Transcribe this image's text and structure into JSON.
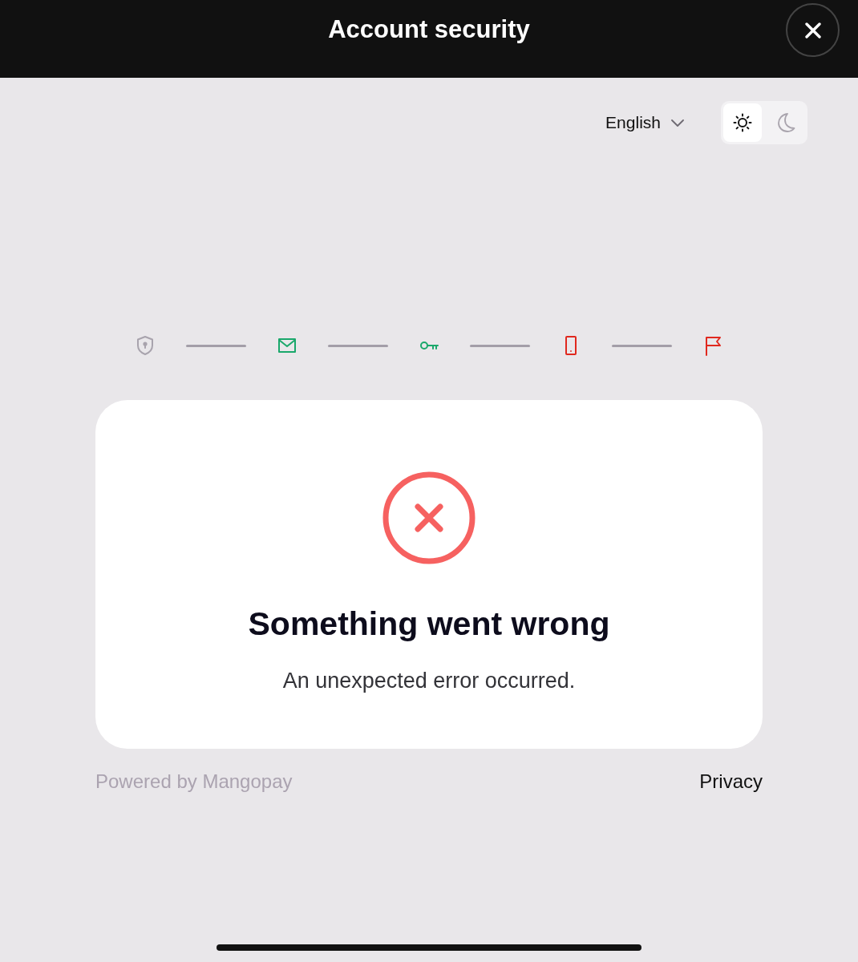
{
  "header": {
    "title": "Account security"
  },
  "toolbar": {
    "language": "English",
    "theme_options": [
      {
        "kind": "light",
        "selected": true
      },
      {
        "kind": "dark",
        "selected": false
      }
    ]
  },
  "steps": [
    {
      "kind": "shield",
      "color": "#a8a3ad"
    },
    {
      "kind": "mail",
      "color": "#1aa86b"
    },
    {
      "kind": "key",
      "color": "#1aa86b"
    },
    {
      "kind": "phone",
      "color": "#e0281e"
    },
    {
      "kind": "flag",
      "color": "#e0281e"
    }
  ],
  "error_card": {
    "title": "Something went wrong",
    "message": "An unexpected error occurred."
  },
  "footer": {
    "powered_by": "Powered by Mangopay",
    "privacy_link": "Privacy"
  }
}
